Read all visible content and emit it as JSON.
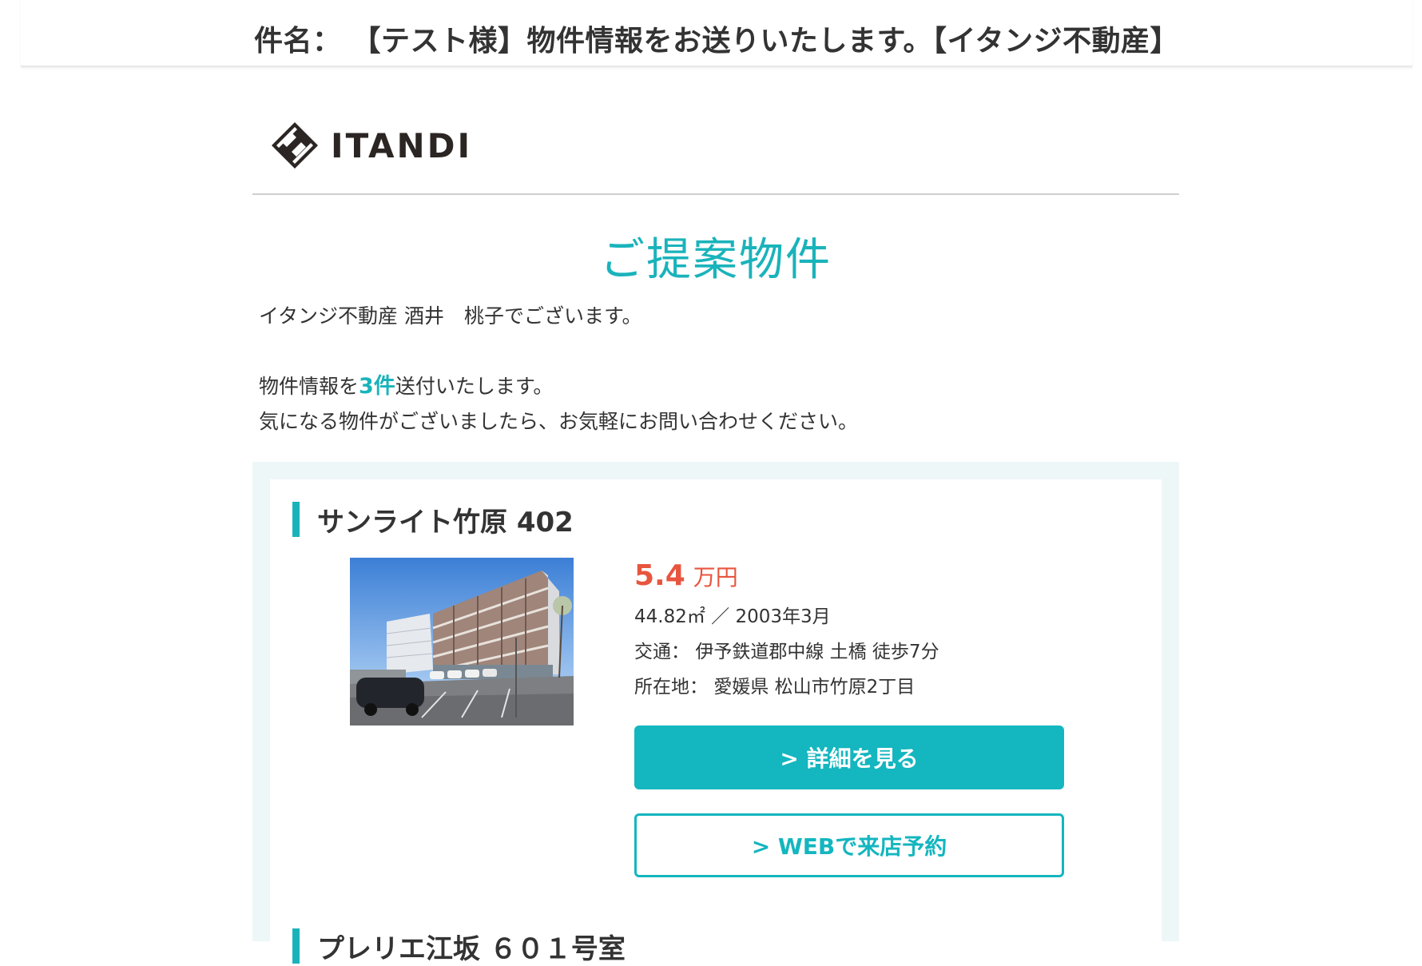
{
  "email": {
    "subject_label": "件名：",
    "subject": "【テスト様】物件情報をお送りいたします。【イタンジ不動産】"
  },
  "logo": {
    "text": "ITANDI",
    "icon": "itandi-logo-mark"
  },
  "section_title": "ご提案物件",
  "intro": {
    "greeting": "イタンジ不動産 酒井　桃子でございます。",
    "line1_before": "物件情報を",
    "count": "3件",
    "line1_after": "送付いたします。",
    "line2": "気になる物件がございましたら、お気軽にお問い合わせください。"
  },
  "properties": [
    {
      "name": "サンライト竹原 402",
      "price": "5.4",
      "price_unit": "万円",
      "area_built": "44.82㎡ ／ 2003年3月",
      "access_label": "交通：",
      "access": "伊予鉄道郡中線 土橋 徒歩7分",
      "address_label": "所在地：",
      "address": "愛媛県 松山市竹原2丁目",
      "detail_button": "> 詳細を見る",
      "reserve_button": "> WEBで来店予約"
    },
    {
      "name": "プレリエ江坂 ６０１号室"
    }
  ],
  "colors": {
    "accent": "#1ab3bb",
    "price": "#e8553e",
    "panel_bg": "#eef7f7"
  }
}
